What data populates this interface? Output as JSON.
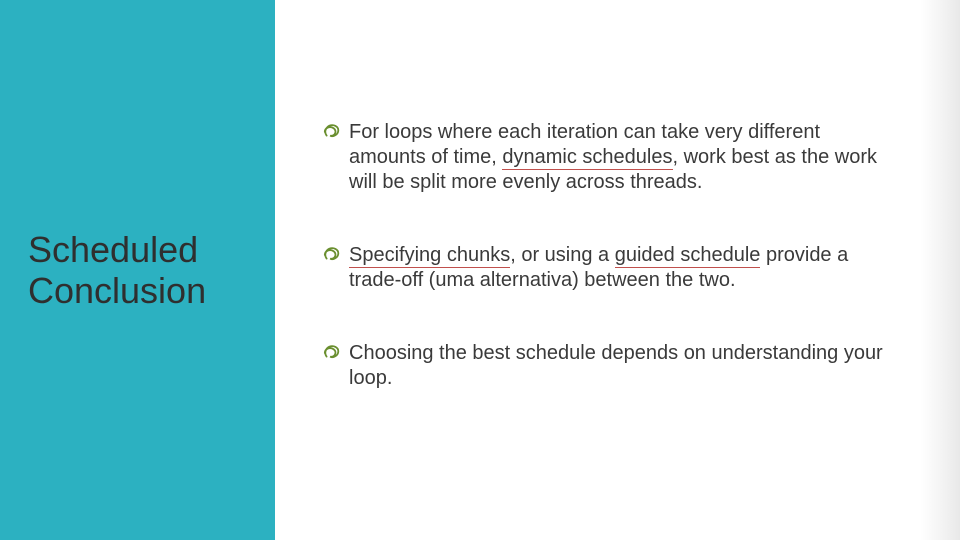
{
  "slide": {
    "title": "Scheduled Conclusion",
    "bullets": [
      {
        "parts": [
          {
            "text": "For loops where each iteration can take very different amounts of time, "
          },
          {
            "text": "dynamic schedules",
            "underline": true
          },
          {
            "text": ", work best as the work will be split more evenly across threads."
          }
        ]
      },
      {
        "parts": [
          {
            "text": "Specifying chunks",
            "underline": true
          },
          {
            "text": ", or using a "
          },
          {
            "text": "guided schedule",
            "underline": true
          },
          {
            "text": " provide a trade-off (uma alternativa) between the two."
          }
        ]
      },
      {
        "parts": [
          {
            "text": "Choosing the best schedule depends on understanding your loop."
          }
        ]
      }
    ],
    "icon_name": "scrawl-bullet-icon",
    "colors": {
      "accent_panel": "#2cb1c1",
      "bullet_icon": "#6a8f2f",
      "underline": "#c0504d"
    }
  }
}
